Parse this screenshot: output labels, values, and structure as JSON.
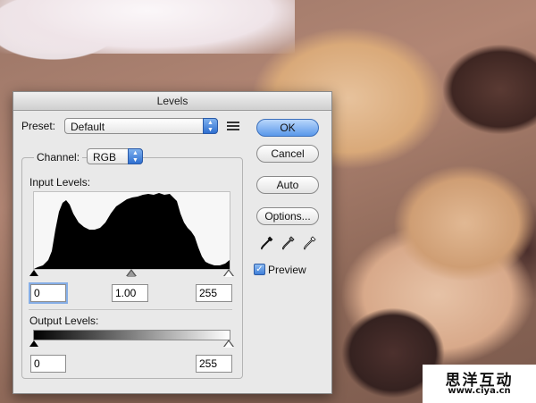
{
  "dialog": {
    "title": "Levels",
    "preset": {
      "label": "Preset:",
      "value": "Default"
    },
    "channel": {
      "label": "Channel:",
      "value": "RGB"
    },
    "input_levels": {
      "label": "Input Levels:",
      "black": "0",
      "gamma": "1.00",
      "white": "255"
    },
    "output_levels": {
      "label": "Output Levels:",
      "black": "0",
      "white": "255"
    },
    "buttons": {
      "ok": "OK",
      "cancel": "Cancel",
      "auto": "Auto",
      "options": "Options..."
    },
    "preview": {
      "label": "Preview",
      "checked": true
    }
  },
  "watermark": {
    "line1": "思洋互动",
    "line2": "www.ciya.cn"
  },
  "colors": {
    "accent": "#5a98ea",
    "dialog_bg": "#e9e9e9"
  }
}
